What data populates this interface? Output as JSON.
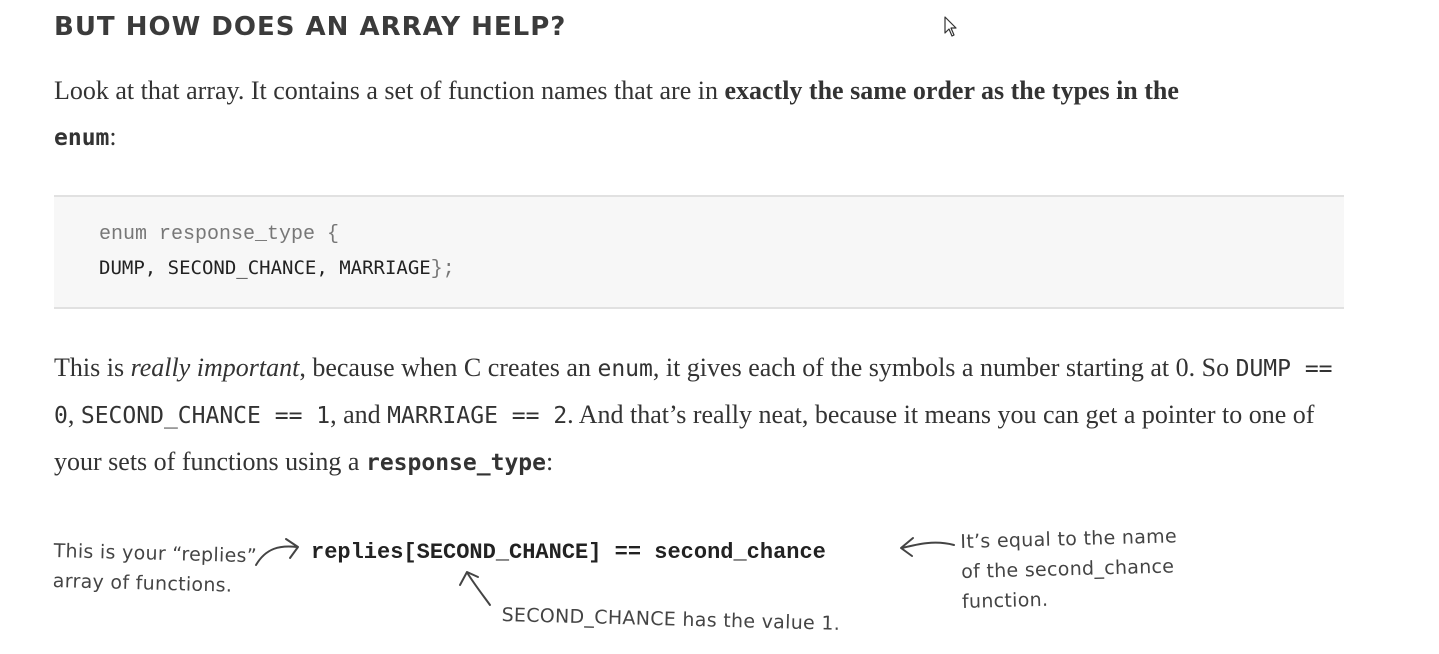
{
  "section": {
    "heading": "BUT HOW DOES AN ARRAY HELP?"
  },
  "para1": {
    "text1": "Look at that array. It contains a set of function names that are in ",
    "bold1": "exactly the same order as the types in the",
    "code1": "enum",
    "text2": ":"
  },
  "code_block": {
    "line1": "enum response_type {",
    "line2_consts": "DUMP, SECOND_CHANCE, MARRIAGE",
    "line2_end": "};"
  },
  "para2": {
    "t1": "This is ",
    "em1": "really important",
    "t2": ", because when C creates an ",
    "c1": "enum",
    "t3": ", it gives each of the symbols a number starting at 0. So ",
    "c2": "DUMP == 0",
    "t4": ", ",
    "c3": "SECOND_CHANCE == 1",
    "t5": ", and ",
    "c4": "MARRIAGE == 2",
    "t6": ". And that’s really neat, because it means you can get a pointer to one of your sets of functions using a ",
    "c5": "response_type",
    "t7": ":"
  },
  "annotation": {
    "left_note": "This is your “replies”\narray of functions.",
    "expression": "replies[SECOND_CHANCE] == second_chance",
    "right_note": "It’s equal to the name\nof the second_chance\nfunction.",
    "bottom_note": "SECOND_CHANCE has the value 1."
  }
}
